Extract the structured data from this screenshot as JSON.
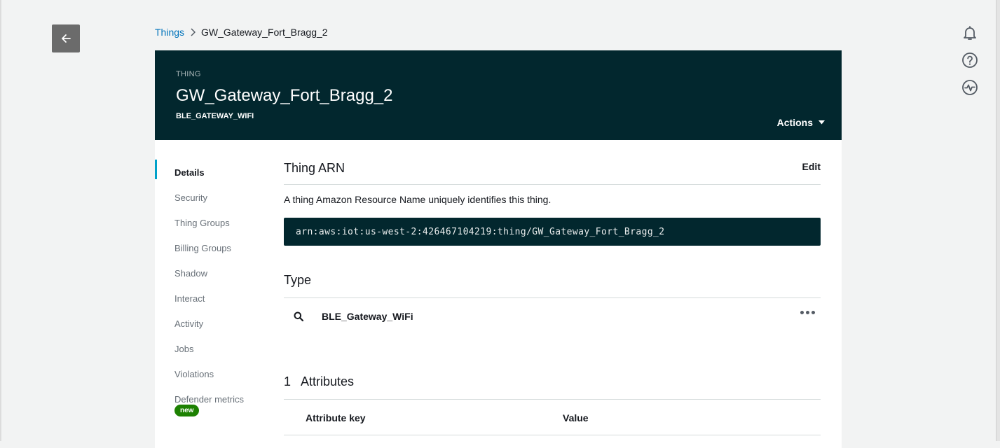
{
  "breadcrumb": {
    "parent": "Things",
    "current": "GW_Gateway_Fort_Bragg_2"
  },
  "hero": {
    "kind": "THING",
    "title": "GW_Gateway_Fort_Bragg_2",
    "subtype": "BLE_GATEWAY_WIFI",
    "actions_label": "Actions"
  },
  "side_nav": {
    "items": [
      {
        "label": "Details",
        "active": true
      },
      {
        "label": "Security"
      },
      {
        "label": "Thing Groups"
      },
      {
        "label": "Billing Groups"
      },
      {
        "label": "Shadow"
      },
      {
        "label": "Interact"
      },
      {
        "label": "Activity"
      },
      {
        "label": "Jobs"
      },
      {
        "label": "Violations"
      },
      {
        "label": "Defender metrics"
      }
    ],
    "new_badge": "new"
  },
  "arn_section": {
    "title": "Thing ARN",
    "edit_label": "Edit",
    "description": "A thing Amazon Resource Name uniquely identifies this thing.",
    "arn": "arn:aws:iot:us-west-2:426467104219:thing/GW_Gateway_Fort_Bragg_2"
  },
  "type_section": {
    "title": "Type",
    "type_name": "BLE_Gateway_WiFi"
  },
  "attributes_section": {
    "count": "1",
    "title": "Attributes",
    "col_key": "Attribute key",
    "col_value": "Value"
  },
  "icons": {
    "back": "arrow-left-icon",
    "notifications": "bell-icon",
    "help": "question-circle-icon",
    "health": "pulse-icon",
    "search": "search-icon",
    "more": "ellipsis-icon",
    "dropdown": "caret-down-icon"
  },
  "colors": {
    "hero_bg": "#02272e",
    "link": "#0073bb",
    "active_indicator": "#00a1c9",
    "badge": "#1d8102"
  }
}
